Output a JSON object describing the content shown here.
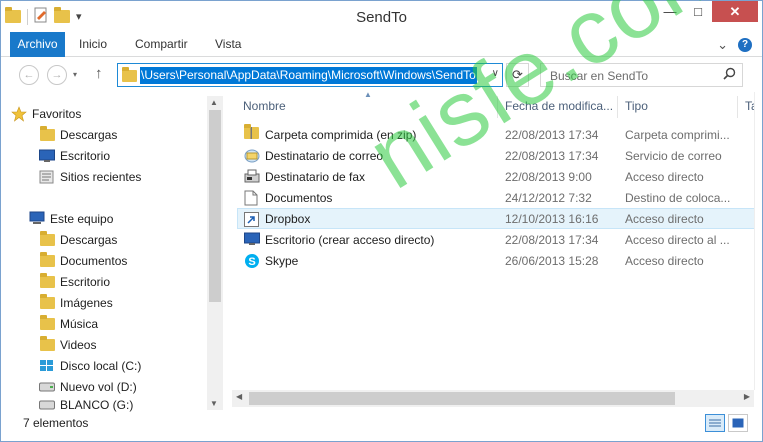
{
  "window": {
    "title": "SendTo",
    "qat_more_label": "▾"
  },
  "window_buttons": {
    "minimize": "—",
    "maximize": "□",
    "close": "✕"
  },
  "ribbon": {
    "tabs": [
      "Archivo",
      "Inicio",
      "Compartir",
      "Vista"
    ],
    "expand_label": "⌄",
    "help_label": "?"
  },
  "address_bar": {
    "back": "←",
    "forward": "→",
    "up": "↑",
    "path": "\\Users\\Personal\\AppData\\Roaming\\Microsoft\\Windows\\SendTo",
    "dropdown": "∨",
    "refresh": "⟳",
    "search_placeholder": "Buscar en SendTo"
  },
  "nav_pane": {
    "favorites": {
      "label": "Favoritos",
      "items": [
        "Descargas",
        "Escritorio",
        "Sitios recientes"
      ]
    },
    "this_pc": {
      "label": "Este equipo",
      "items": [
        "Descargas",
        "Documentos",
        "Escritorio",
        "Imágenes",
        "Música",
        "Videos",
        "Disco local (C:)",
        "Nuevo vol (D:)",
        "BLANCO (G:)"
      ]
    }
  },
  "file_list": {
    "columns": [
      "Nombre",
      "Fecha de modifica...",
      "Tipo",
      "Ta"
    ],
    "rows": [
      {
        "name": "Carpeta comprimida (en zip)",
        "date": "22/08/2013 17:34",
        "type": "Carpeta comprimi...",
        "icon": "zip-folder-icon"
      },
      {
        "name": "Destinatario de correo",
        "date": "22/08/2013 17:34",
        "type": "Servicio de correo",
        "icon": "mail-icon"
      },
      {
        "name": "Destinatario de fax",
        "date": "22/08/2013 9:00",
        "type": "Acceso directo",
        "icon": "fax-icon"
      },
      {
        "name": "Documentos",
        "date": "24/12/2012 7:32",
        "type": "Destino de coloca...",
        "icon": "document-icon"
      },
      {
        "name": "Dropbox",
        "date": "12/10/2013 16:16",
        "type": "Acceso directo",
        "icon": "shortcut-icon"
      },
      {
        "name": "Escritorio (crear acceso directo)",
        "date": "22/08/2013 17:34",
        "type": "Acceso directo al ...",
        "icon": "desktop-icon"
      },
      {
        "name": "Skype",
        "date": "26/06/2013 15:28",
        "type": "Acceso directo",
        "icon": "skype-icon"
      }
    ]
  },
  "status_bar": {
    "item_count": "7 elementos"
  },
  "watermark": "nisfe.com",
  "colors": {
    "accent": "#1979ca",
    "selection": "#0078d7",
    "watermark": "#2ecc40"
  }
}
